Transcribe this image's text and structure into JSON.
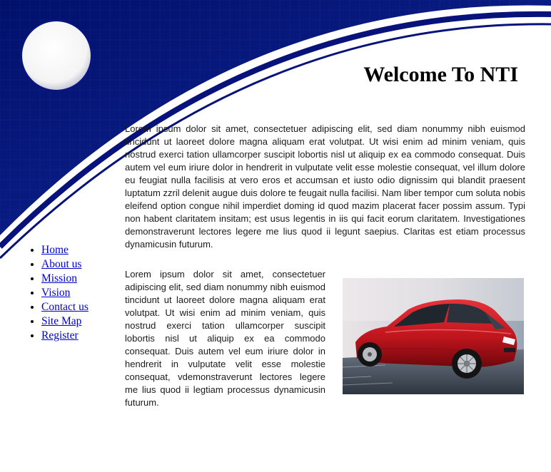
{
  "header": {
    "title": "Welcome To NTI"
  },
  "nav": [
    {
      "label": "Home"
    },
    {
      "label": "About us"
    },
    {
      "label": "Mission"
    },
    {
      "label": "Vision"
    },
    {
      "label": "Contact us"
    },
    {
      "label": "Site Map"
    },
    {
      "label": "Register"
    }
  ],
  "content": {
    "paragraph1": "Lorem ipsum dolor sit amet, consectetuer adipiscing elit, sed diam nonummy nibh euismod tincidunt ut laoreet dolore magna aliquam erat volutpat. Ut wisi enim ad minim veniam, quis nostrud exerci tation ullamcorper suscipit lobortis nisl ut aliquip ex ea commodo consequat. Duis autem vel eum iriure dolor in hendrerit in vulputate velit esse molestie consequat, vel illum dolore eu feugiat nulla facilisis at vero eros et accumsan et iusto odio dignissim qui blandit praesent luptatum zzril delenit augue duis dolore te feugait nulla facilisi. Nam liber tempor cum soluta nobis eleifend option congue nihil imperdiet doming id quod mazim placerat facer possim assum. Typi non habent claritatem insitam; est usus legentis in iis qui facit eorum claritatem. Investigationes demonstraverunt lectores legere me lius quod ii legunt saepius. Claritas est etiam processus dynamicusin futurum.",
    "paragraph2": "Lorem ipsum dolor sit amet, consectetuer adipiscing elit, sed diam nonummy nibh euismod tincidunt ut laoreet dolore magna aliquam erat volutpat. Ut wisi enim ad minim veniam, quis nostrud exerci tation ullamcorper suscipit lobortis nisl ut aliquip ex ea commodo consequat. Duis autem vel eum iriure dolor in hendrerit in vulputate velit esse molestie consequat, vdemonstraverunt lectores legere me lius quod ii legtiam processus dynamicusin futurum."
  },
  "image": {
    "subject": "red-car-photo"
  },
  "colors": {
    "banner_dark": "#00106a",
    "banner_mid": "#0a1f8f",
    "link": "#0000cc"
  }
}
